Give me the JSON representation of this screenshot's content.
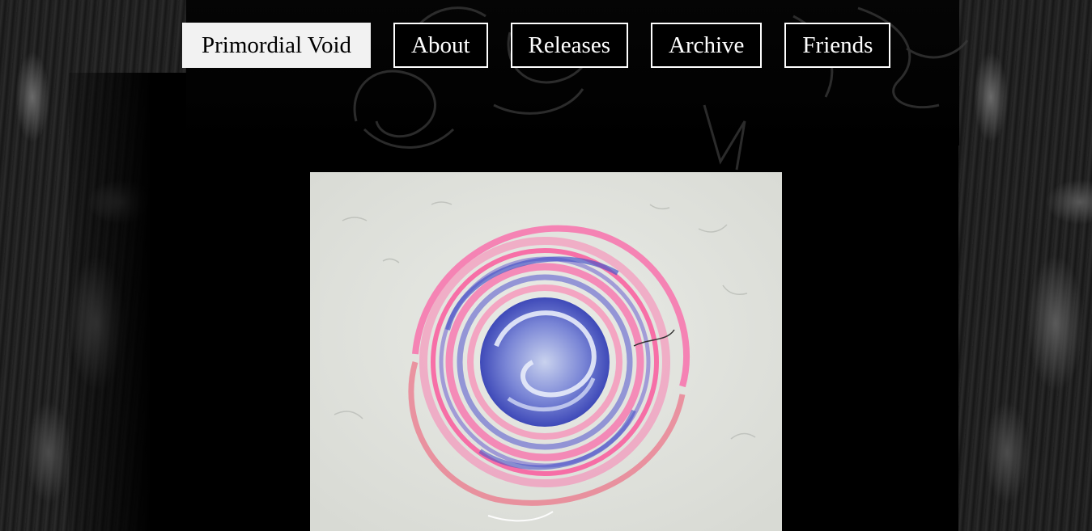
{
  "nav": {
    "home_label": "Primordial Void",
    "items": [
      {
        "label": "About"
      },
      {
        "label": "Releases"
      },
      {
        "label": "Archive"
      },
      {
        "label": "Friends"
      }
    ]
  },
  "colors": {
    "page_background": "#000000",
    "nav_active_bg": "#f2f2f2",
    "nav_border": "#ffffff",
    "artwork_pink": "#ff4fa0",
    "artwork_blue": "#4a55c8",
    "artwork_paper": "#dfe1dc"
  },
  "artwork": {
    "subject": "pink and blue swirl painting"
  }
}
